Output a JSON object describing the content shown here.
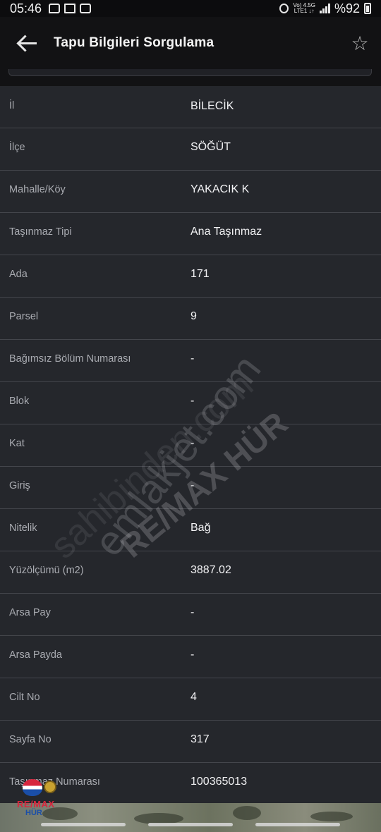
{
  "status_bar": {
    "time": "05:46",
    "net_top": "Vo) 4.5G",
    "net_bottom": "LTE1 ↓↑",
    "battery": "%92"
  },
  "header": {
    "title": "Tapu Bilgileri Sorgulama"
  },
  "rows": [
    {
      "label": "İl",
      "value": "BİLECİK"
    },
    {
      "label": "İlçe",
      "value": "SÖĞÜT"
    },
    {
      "label": "Mahalle/Köy",
      "value": "YAKACIK K"
    },
    {
      "label": "Taşınmaz Tipi",
      "value": "Ana Taşınmaz"
    },
    {
      "label": "Ada",
      "value": "171"
    },
    {
      "label": "Parsel",
      "value": "9"
    },
    {
      "label": "Bağımsız Bölüm Numarası",
      "value": "-"
    },
    {
      "label": "Blok",
      "value": "-"
    },
    {
      "label": "Kat",
      "value": "-"
    },
    {
      "label": "Giriş",
      "value": "-"
    },
    {
      "label": "Nitelik",
      "value": "Bağ"
    },
    {
      "label": "Yüzölçümü (m2)",
      "value": "3887.02"
    },
    {
      "label": "Arsa Pay",
      "value": "-"
    },
    {
      "label": "Arsa Payda",
      "value": "-"
    },
    {
      "label": "Cilt No",
      "value": "4"
    },
    {
      "label": "Sayfa No",
      "value": "317"
    },
    {
      "label": "Taşınmaz Numarası",
      "value": "100365013"
    }
  ],
  "watermarks": {
    "wm1": "emlakjet.com",
    "wm2": "RE/MAX HÜR",
    "wm3": "sahibinden.com"
  },
  "logo": {
    "brand": "RE/MAX",
    "sub": "HÜR"
  },
  "icons": {
    "back": "arrow-left-icon",
    "favorite": "star-outline-icon"
  }
}
